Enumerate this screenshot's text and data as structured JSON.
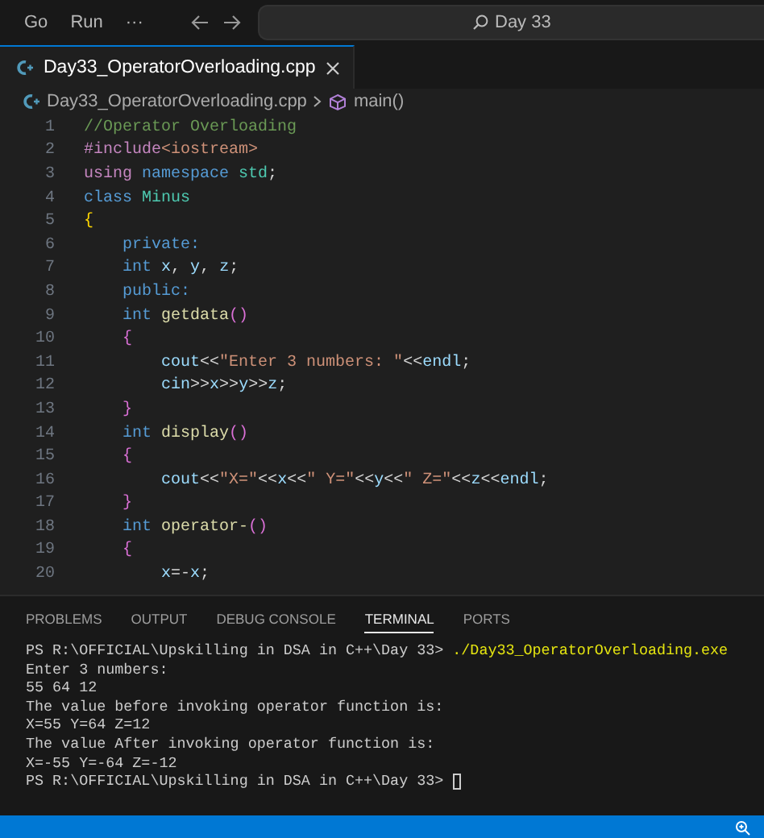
{
  "title_bar": {
    "menu": [
      "Go",
      "Run",
      "···"
    ],
    "search": {
      "value": "Day 33"
    }
  },
  "tabs": [
    {
      "label": "Day33_OperatorOverloading.cpp",
      "selected": true
    }
  ],
  "breadcrumb": {
    "file": "Day33_OperatorOverloading.cpp",
    "symbol": "main()"
  },
  "code": [
    {
      "number": "1",
      "tokens": [
        {
          "kind": "comment",
          "text": "//Operator Overloading"
        }
      ]
    },
    {
      "number": "2",
      "tokens": [
        {
          "kind": "preproc",
          "text": "#include"
        },
        {
          "kind": "string",
          "text": "<iostream>"
        }
      ]
    },
    {
      "number": "3",
      "tokens": [
        {
          "kind": "control",
          "text": "using"
        },
        {
          "kind": "keyword",
          "text": " namespace"
        },
        {
          "kind": "type",
          "text": " std"
        },
        {
          "kind": "plain",
          "text": ";"
        }
      ]
    },
    {
      "number": "4",
      "tokens": [
        {
          "kind": "keyword",
          "text": "class"
        },
        {
          "kind": "type",
          "text": " Minus"
        }
      ]
    },
    {
      "number": "5",
      "tokens": [
        {
          "kind": "brace1",
          "text": "{"
        }
      ]
    },
    {
      "number": "6",
      "tokens": [
        {
          "kind": "keyword",
          "text": "    private:"
        }
      ]
    },
    {
      "number": "7",
      "tokens": [
        {
          "kind": "keyword",
          "text": "    int"
        },
        {
          "kind": "var",
          "text": " x"
        },
        {
          "kind": "plain",
          "text": ","
        },
        {
          "kind": "var",
          "text": " y"
        },
        {
          "kind": "plain",
          "text": ","
        },
        {
          "kind": "var",
          "text": " z"
        },
        {
          "kind": "plain",
          "text": ";"
        }
      ]
    },
    {
      "number": "8",
      "tokens": [
        {
          "kind": "keyword",
          "text": "    public:"
        }
      ]
    },
    {
      "number": "9",
      "tokens": [
        {
          "kind": "keyword",
          "text": "    int"
        },
        {
          "kind": "func",
          "text": " getdata"
        },
        {
          "kind": "brace2",
          "text": "()"
        }
      ]
    },
    {
      "number": "10",
      "tokens": [
        {
          "kind": "brace2",
          "text": "    {"
        }
      ]
    },
    {
      "number": "11",
      "tokens": [
        {
          "kind": "var",
          "text": "        cout"
        },
        {
          "kind": "plain",
          "text": "<<"
        },
        {
          "kind": "string",
          "text": "\"Enter 3 numbers: \""
        },
        {
          "kind": "plain",
          "text": "<<"
        },
        {
          "kind": "var",
          "text": "endl"
        },
        {
          "kind": "plain",
          "text": ";"
        }
      ]
    },
    {
      "number": "12",
      "tokens": [
        {
          "kind": "var",
          "text": "        cin"
        },
        {
          "kind": "plain",
          "text": ">>"
        },
        {
          "kind": "var",
          "text": "x"
        },
        {
          "kind": "plain",
          "text": ">>"
        },
        {
          "kind": "var",
          "text": "y"
        },
        {
          "kind": "plain",
          "text": ">>"
        },
        {
          "kind": "var",
          "text": "z"
        },
        {
          "kind": "plain",
          "text": ";"
        }
      ]
    },
    {
      "number": "13",
      "tokens": [
        {
          "kind": "brace2",
          "text": "    }"
        }
      ]
    },
    {
      "number": "14",
      "tokens": [
        {
          "kind": "keyword",
          "text": "    int"
        },
        {
          "kind": "func",
          "text": " display"
        },
        {
          "kind": "brace2",
          "text": "()"
        }
      ]
    },
    {
      "number": "15",
      "tokens": [
        {
          "kind": "brace2",
          "text": "    {"
        }
      ]
    },
    {
      "number": "16",
      "tokens": [
        {
          "kind": "var",
          "text": "        cout"
        },
        {
          "kind": "plain",
          "text": "<<"
        },
        {
          "kind": "string",
          "text": "\"X=\""
        },
        {
          "kind": "plain",
          "text": "<<"
        },
        {
          "kind": "var",
          "text": "x"
        },
        {
          "kind": "plain",
          "text": "<<"
        },
        {
          "kind": "string",
          "text": "\" Y=\""
        },
        {
          "kind": "plain",
          "text": "<<"
        },
        {
          "kind": "var",
          "text": "y"
        },
        {
          "kind": "plain",
          "text": "<<"
        },
        {
          "kind": "string",
          "text": "\" Z=\""
        },
        {
          "kind": "plain",
          "text": "<<"
        },
        {
          "kind": "var",
          "text": "z"
        },
        {
          "kind": "plain",
          "text": "<<"
        },
        {
          "kind": "var",
          "text": "endl"
        },
        {
          "kind": "plain",
          "text": ";"
        }
      ]
    },
    {
      "number": "17",
      "tokens": [
        {
          "kind": "brace2",
          "text": "    }"
        }
      ]
    },
    {
      "number": "18",
      "tokens": [
        {
          "kind": "keyword",
          "text": "    int"
        },
        {
          "kind": "func",
          "text": " operator-"
        },
        {
          "kind": "brace2",
          "text": "()"
        }
      ]
    },
    {
      "number": "19",
      "tokens": [
        {
          "kind": "brace2",
          "text": "    {"
        }
      ]
    },
    {
      "number": "20",
      "tokens": [
        {
          "kind": "var",
          "text": "        x"
        },
        {
          "kind": "plain",
          "text": "=-"
        },
        {
          "kind": "var",
          "text": "x"
        },
        {
          "kind": "plain",
          "text": ";"
        }
      ]
    }
  ],
  "panel_tabs": [
    {
      "label": "PROBLEMS",
      "selected": false
    },
    {
      "label": "OUTPUT",
      "selected": false
    },
    {
      "label": "DEBUG CONSOLE",
      "selected": false
    },
    {
      "label": "TERMINAL",
      "selected": true
    },
    {
      "label": "PORTS",
      "selected": false
    }
  ],
  "terminal": {
    "cursor": true,
    "lines": [
      {
        "text": "PS R:\\OFFICIAL\\Upskilling in DSA in C++\\Day 33> ",
        "command": "./Day33_OperatorOverloading.exe"
      },
      {
        "text": "Enter 3 numbers:"
      },
      {
        "text": "55 64 12"
      },
      {
        "text": "The value before invoking operator function is:"
      },
      {
        "text": "X=55 Y=64 Z=12"
      },
      {
        "text": "The value After invoking operator function is:"
      },
      {
        "text": "X=-55 Y=-64 Z=-12"
      },
      {
        "text": "PS R:\\OFFICIAL\\Upskilling in DSA in C++\\Day 33> "
      }
    ]
  }
}
